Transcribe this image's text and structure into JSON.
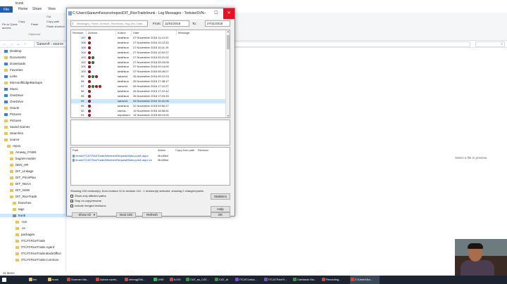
{
  "explorer": {
    "title": "trunk",
    "tabs": [
      "File",
      "Home",
      "Share",
      "View"
    ],
    "ribbon": {
      "pin_label": "Pin to Quick access",
      "copy_label": "Copy",
      "paste_label": "Paste",
      "cut_label": "Cut",
      "copy_path_label": "Copy path",
      "paste_shortcut_label": "Paste shortcut",
      "clipboard_group": "Clipboard"
    },
    "address": [
      "Saravn4",
      "source"
    ],
    "nav": [
      {
        "label": "Desktop",
        "sel": false,
        "blue": true,
        "indent": 0
      },
      {
        "label": "Documents",
        "sel": false,
        "blue": false,
        "indent": 0
      },
      {
        "label": "Downloads",
        "sel": false,
        "blue": true,
        "indent": 0
      },
      {
        "label": "Favorites",
        "sel": false,
        "blue": false,
        "indent": 0
      },
      {
        "label": "Links",
        "sel": false,
        "blue": true,
        "indent": 0
      },
      {
        "label": "MicrosoftEdgeBackups",
        "sel": false,
        "blue": false,
        "indent": 0
      },
      {
        "label": "Music",
        "sel": false,
        "blue": true,
        "indent": 0
      },
      {
        "label": "OneDrive",
        "sel": false,
        "blue": true,
        "indent": 0
      },
      {
        "label": "OneDrive",
        "sel": false,
        "blue": true,
        "indent": 0
      },
      {
        "label": "Oracle",
        "sel": false,
        "blue": false,
        "indent": 0
      },
      {
        "label": "Pictures",
        "sel": false,
        "blue": true,
        "indent": 0
      },
      {
        "label": "Pictures",
        "sel": false,
        "blue": false,
        "indent": 0
      },
      {
        "label": "Saved Games",
        "sel": false,
        "blue": false,
        "indent": 0
      },
      {
        "label": "Searches",
        "sel": false,
        "blue": false,
        "indent": 0
      },
      {
        "label": "source",
        "sel": false,
        "blue": false,
        "indent": 0
      },
      {
        "label": "repos",
        "sel": false,
        "blue": false,
        "indent": 1
      },
      {
        "label": "Amway_FAMS",
        "sel": false,
        "blue": false,
        "indent": 2
      },
      {
        "label": "bugnet-master",
        "sel": false,
        "blue": false,
        "indent": 2
      },
      {
        "label": "DEN_HR",
        "sel": false,
        "blue": false,
        "indent": 2
      },
      {
        "label": "DIT_Linkage",
        "sel": false,
        "blue": false,
        "indent": 2
      },
      {
        "label": "DIT_PricePlan",
        "sel": false,
        "blue": false,
        "indent": 2
      },
      {
        "label": "DIT_NSAA",
        "sel": false,
        "blue": false,
        "indent": 2
      },
      {
        "label": "DIT_NSW",
        "sel": false,
        "blue": false,
        "indent": 2
      },
      {
        "label": "DIT_RiceTrade",
        "sel": false,
        "blue": false,
        "indent": 2
      },
      {
        "label": "branches",
        "sel": false,
        "blue": false,
        "indent": 3
      },
      {
        "label": "tags",
        "sel": false,
        "blue": false,
        "indent": 3
      },
      {
        "label": "trunk",
        "sel": true,
        "blue": false,
        "indent": 3
      },
      {
        "label": ".svn",
        "sel": false,
        "blue": false,
        "indent": 4
      },
      {
        "label": ".vs",
        "sel": false,
        "blue": false,
        "indent": 4
      },
      {
        "label": "packages",
        "sel": false,
        "blue": false,
        "indent": 4
      },
      {
        "label": "ITCAT.RiceTrade",
        "sel": false,
        "blue": false,
        "indent": 4
      },
      {
        "label": "ITCAT.RiceTrade.Agent",
        "sel": false,
        "blue": false,
        "indent": 4
      },
      {
        "label": "ITCAT.RiceTrade.BackOffice",
        "sel": false,
        "blue": false,
        "indent": 4
      },
      {
        "label": "ITCAT.RiceTrade.Common",
        "sel": false,
        "blue": false,
        "indent": 4
      }
    ],
    "empty_text": "Select a file to preview.",
    "status": "11 items"
  },
  "dialog": {
    "title": "C:\\Users\\Saravn4\\source\\repos\\DIT_RiceTrade\\trunk - Log Messages - TortoiseSVN",
    "filter_placeholder": "Messages, Paths, Authors, Revisions, Bug-IDs, Date...",
    "from_label": "From:",
    "from_value": "11/01/2018",
    "to_label": "To:",
    "to_value": "27/11/2018",
    "columns": [
      "Revision",
      "Actions",
      "Author",
      "Date",
      "Message"
    ],
    "rows": [
      {
        "rev": "107",
        "author": "kesthkun",
        "date": "27 November 2018 11:13:47",
        "icons": [
          "r"
        ],
        "sel": false
      },
      {
        "rev": "106",
        "author": "kesthkun",
        "date": "27 November 2018 10:12:20",
        "icons": [
          "r"
        ],
        "sel": false
      },
      {
        "rev": "105",
        "author": "kesthkun",
        "date": "27 November 2018 10:11:19",
        "icons": [
          "r"
        ],
        "sel": false
      },
      {
        "rev": "104",
        "author": "kesthkun",
        "date": "27 November 2018 10:02:27",
        "icons": [
          "r"
        ],
        "sel": false
      },
      {
        "rev": "103",
        "author": "kesthkun",
        "date": "27 November 2018 09:21:02",
        "icons": [
          "r",
          "g"
        ],
        "sel": false
      },
      {
        "rev": "102",
        "author": "kesthkun",
        "date": "27 November 2018 09:15:08",
        "icons": [
          "r",
          "g"
        ],
        "sel": false
      },
      {
        "rev": "101",
        "author": "kesthkun",
        "date": "27 November 2018 09:14:00",
        "icons": [
          "r"
        ],
        "sel": false
      },
      {
        "rev": "100",
        "author": "kesthkun",
        "date": "27 November 2018 08:49:07",
        "icons": [
          "r"
        ],
        "sel": false
      },
      {
        "rev": "99",
        "author": "saravn4",
        "date": "26 November 2018 09:12:23",
        "icons": [
          "r",
          "g",
          "r"
        ],
        "sel": false
      },
      {
        "rev": "98",
        "author": "kesthkun",
        "date": "26 November 2018 17:48:17",
        "icons": [
          "r"
        ],
        "sel": false
      },
      {
        "rev": "97",
        "author": "saravn4",
        "date": "26 November 2018 17:12:27",
        "icons": [
          "r",
          "g",
          "r",
          "r"
        ],
        "sel": false
      },
      {
        "rev": "96",
        "author": "kesthkun",
        "date": "26 November 2018 17:12:42",
        "icons": [
          "r"
        ],
        "sel": false
      },
      {
        "rev": "95",
        "author": "kesthkun",
        "date": "26 November 2018 17:03:39",
        "icons": [
          "r"
        ],
        "sel": false
      },
      {
        "rev": "94",
        "author": "saravn4",
        "date": "26 November 2018 16:41:06",
        "icons": [
          "r"
        ],
        "sel": true
      },
      {
        "rev": "93",
        "author": "kesthkun",
        "date": "22 November 2018 09:50:27",
        "icons": [
          "r"
        ],
        "sel": false
      },
      {
        "rev": "92",
        "author": "ratcha...",
        "date": "19 November 2018 18:06:51",
        "icons": [
          "r"
        ],
        "sel": false
      },
      {
        "rev": "91",
        "author": "suparkorn",
        "date": "14 November 2018 08:13:00",
        "icons": [
          "r"
        ],
        "sel": false
      }
    ],
    "path_columns": [
      "Path",
      "Action",
      "Copy from path",
      "Revision"
    ],
    "paths": [
      {
        "path": "/trunk/ITCAT.RiceTrade/Member/RequestHistoryList1.aspx",
        "action": "Modified"
      },
      {
        "path": "/trunk/ITCAT.RiceTrade/Member/RequestHistoryList1.aspx.cs",
        "action": "Modified"
      }
    ],
    "status": "Showing 100 revision(s), from revision 11 to revision 110 - 1 revision(s) selected, showing 2 changed paths",
    "checks": [
      {
        "label": "Show only affected paths",
        "checked": false
      },
      {
        "label": "Stop on copy/rename",
        "checked": true
      },
      {
        "label": "Include merged revisions",
        "checked": false
      }
    ],
    "buttons": {
      "statistics": "Statistics",
      "help": "Help",
      "show_all": "Show All",
      "next_100": "Next 100",
      "refresh": "Refresh",
      "ok": "OK"
    }
  },
  "taskbar": {
    "items": [
      {
        "label": "bin",
        "color": "#e8c55c"
      },
      {
        "label": "trunk",
        "color": "#e8c55c"
      },
      {
        "label": "Summer Ma...",
        "color": "#d9432f"
      },
      {
        "label": "Advice usefu...",
        "color": "#d9432f"
      },
      {
        "label": "zhemg(lShi...",
        "color": "#d9432f"
      },
      {
        "label": "LINE",
        "color": "#2ec44b"
      },
      {
        "label": "ILOG",
        "color": "#d9432f"
      },
      {
        "label": "CAT_ss_CAT...",
        "color": "#2e9e3d"
      },
      {
        "label": "CAT_sf",
        "color": "#2e9e3d"
      },
      {
        "label": "ITCAT.Linka...",
        "color": "#7b4fc9"
      },
      {
        "label": "ITCAT.RiceTr...",
        "color": "#7b4fc9"
      },
      {
        "label": "Camtasia Stu...",
        "color": "#2e9e3d"
      },
      {
        "label": "Recording...",
        "color": "#d9432f"
      },
      {
        "label": "C:\\Users\\Sa...",
        "color": "#d9432f"
      }
    ],
    "clock_time": "",
    "clock_date": ""
  }
}
